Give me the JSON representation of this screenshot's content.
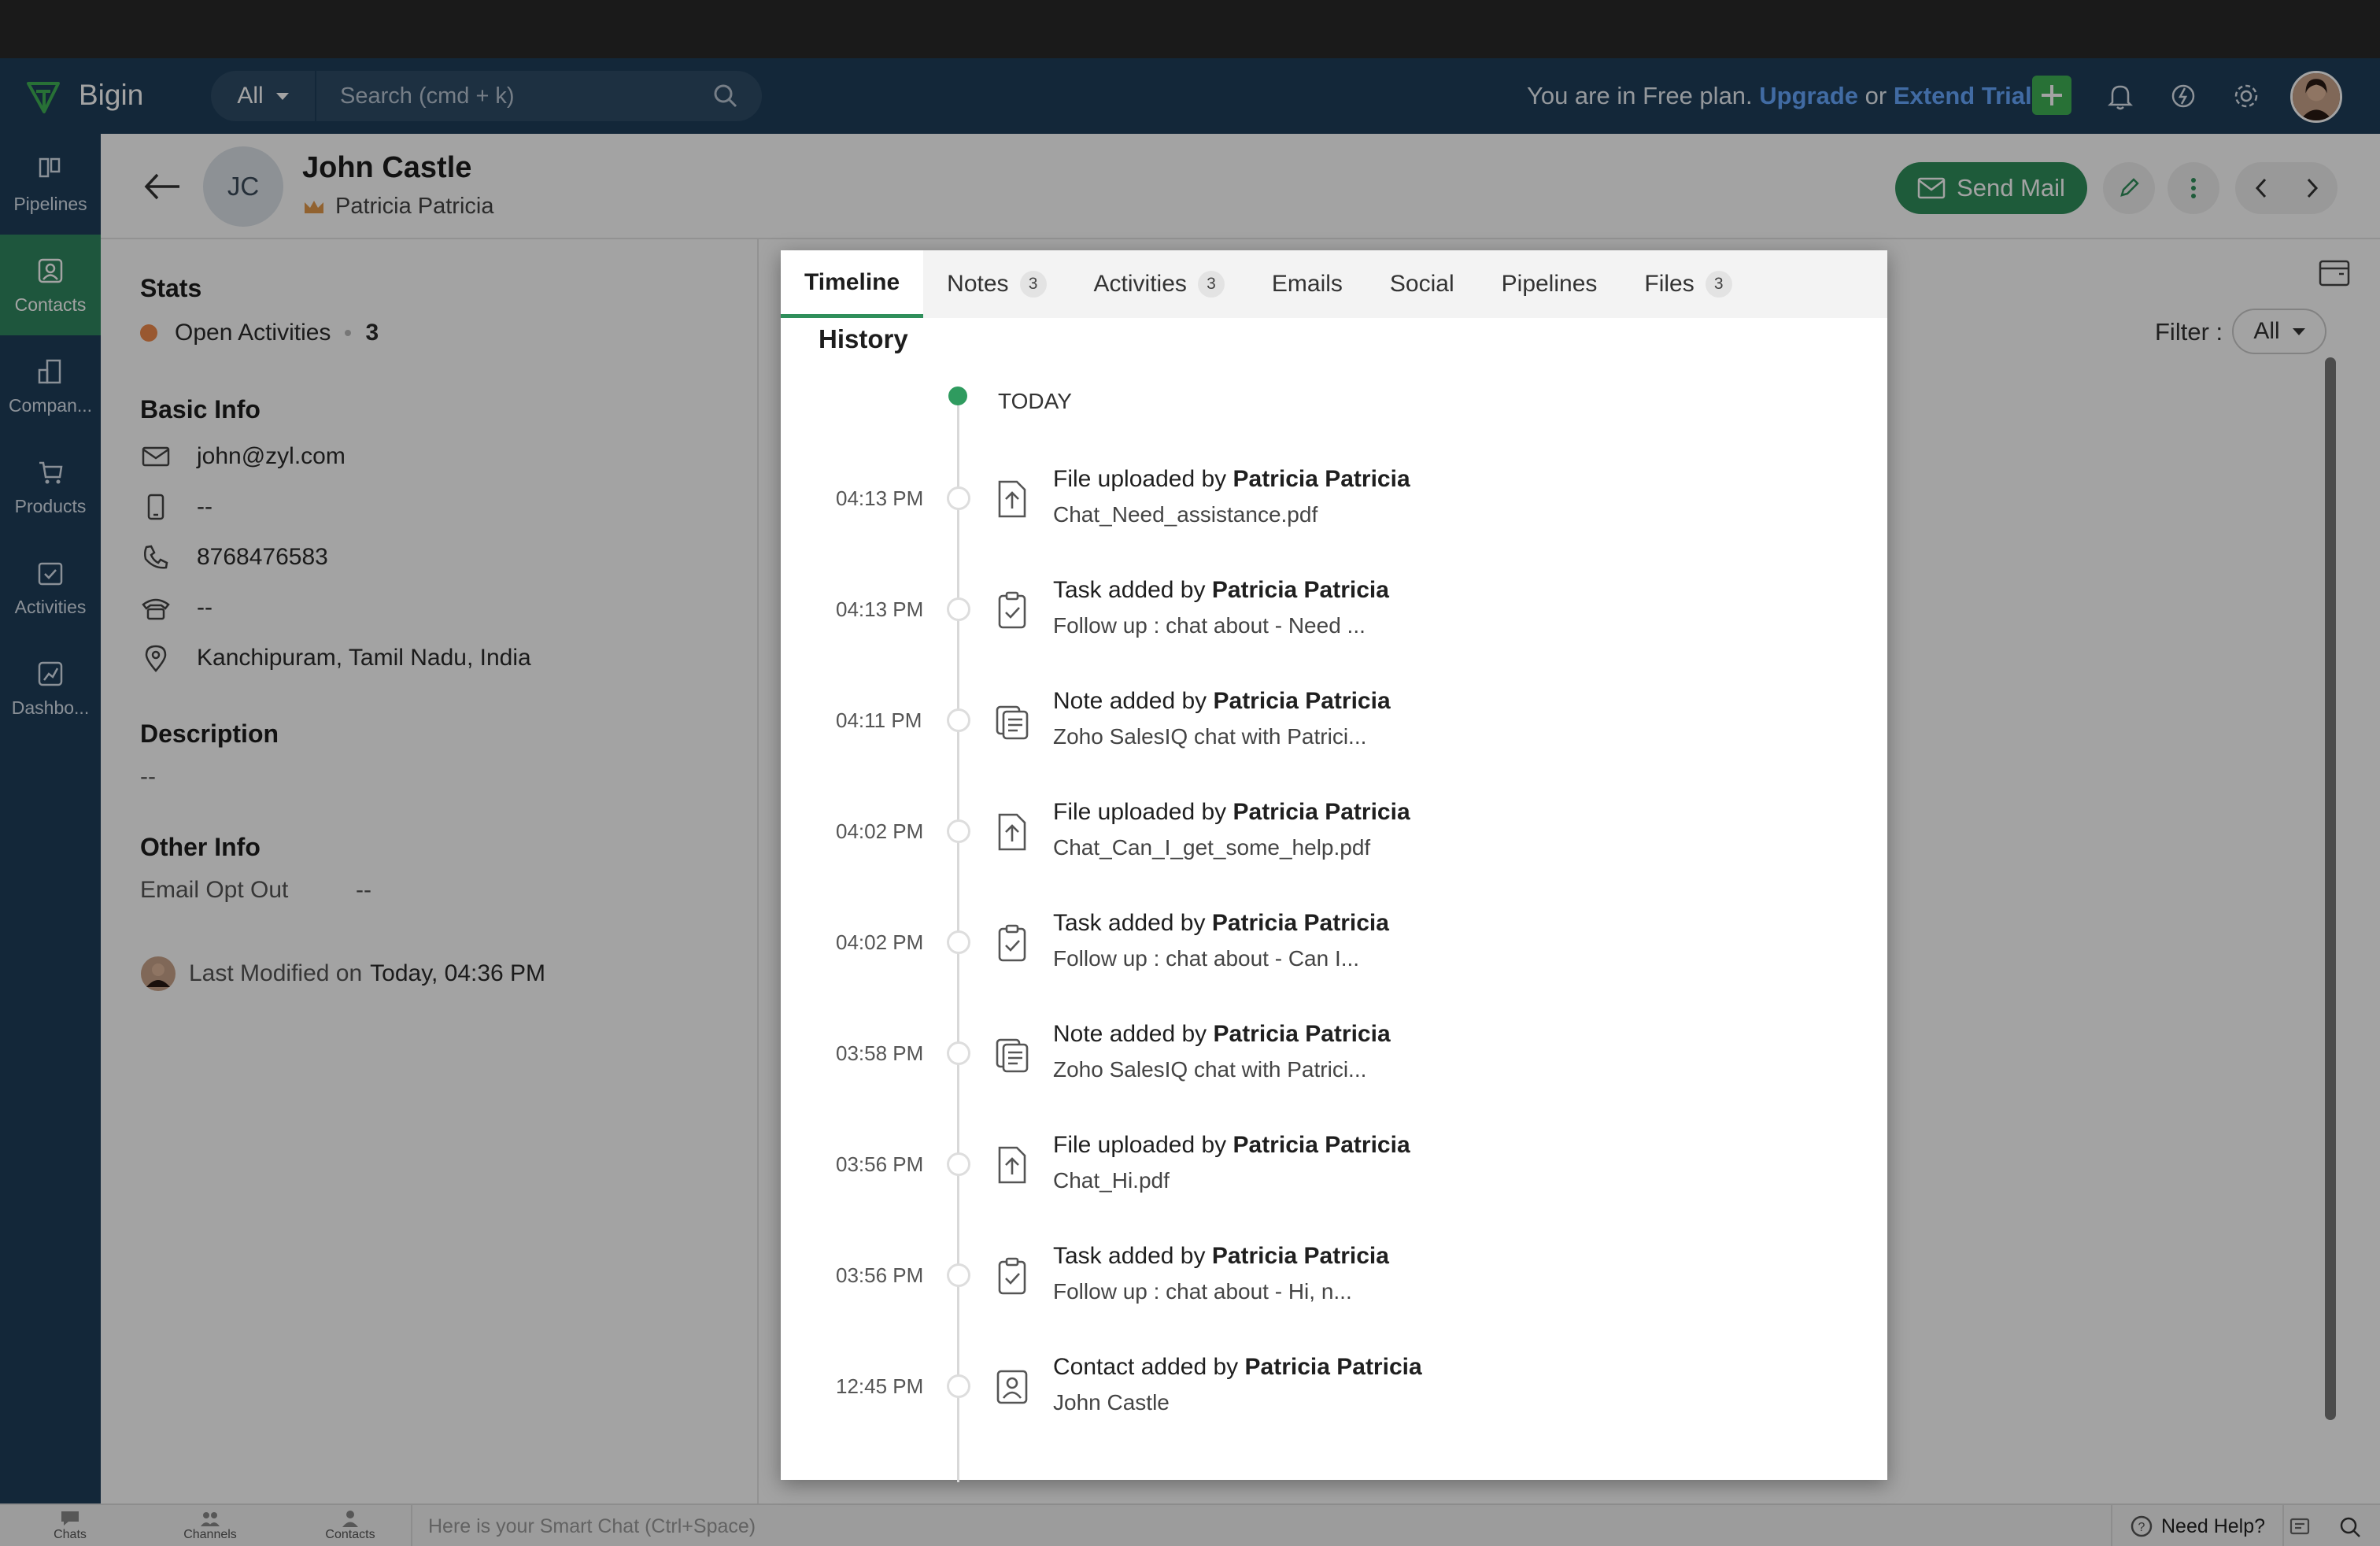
{
  "app": {
    "name": "Bigin"
  },
  "topbar": {
    "search_scope": "All",
    "search_placeholder": "Search (cmd + k)",
    "plan_text": "You are in Free plan.",
    "upgrade": "Upgrade",
    "or": "or",
    "extend_trial": "Extend Trial"
  },
  "sidebar": {
    "items": [
      {
        "label": "Pipelines",
        "icon": "pipelines-icon"
      },
      {
        "label": "Contacts",
        "icon": "contacts-icon",
        "active": true
      },
      {
        "label": "Compan...",
        "icon": "companies-icon"
      },
      {
        "label": "Products",
        "icon": "products-icon"
      },
      {
        "label": "Activities",
        "icon": "activities-icon"
      },
      {
        "label": "Dashbo...",
        "icon": "dashboards-icon"
      }
    ]
  },
  "contact": {
    "initials": "JC",
    "name": "John Castle",
    "owner": "Patricia Patricia",
    "send_mail": "Send Mail"
  },
  "details": {
    "stats_title": "Stats",
    "open_activities_label": "Open Activities",
    "open_activities_count": "3",
    "basic_info_title": "Basic Info",
    "email": "john@zyl.com",
    "mobile": "--",
    "phone": "8768476583",
    "other_phone": "--",
    "address": "Kanchipuram, Tamil Nadu, India",
    "description_title": "Description",
    "description": "--",
    "other_info_title": "Other Info",
    "email_opt_out_label": "Email Opt Out",
    "email_opt_out_value": "--",
    "last_modified_label": "Last Modified on",
    "last_modified_value": "Today, 04:36 PM"
  },
  "filter": {
    "label": "Filter :",
    "value": "All"
  },
  "tabs": [
    {
      "label": "Timeline",
      "count": ""
    },
    {
      "label": "Notes",
      "count": "3"
    },
    {
      "label": "Activities",
      "count": "3"
    },
    {
      "label": "Emails",
      "count": ""
    },
    {
      "label": "Social",
      "count": ""
    },
    {
      "label": "Pipelines",
      "count": ""
    },
    {
      "label": "Files",
      "count": "3"
    }
  ],
  "timeline": {
    "history_title": "History",
    "today_label": "TODAY",
    "events": [
      {
        "time": "04:13 PM",
        "type": "file",
        "action": "File uploaded by",
        "user": "Patricia Patricia",
        "detail": "Chat_Need_assistance.pdf"
      },
      {
        "time": "04:13 PM",
        "type": "task",
        "action": "Task added by",
        "user": "Patricia Patricia",
        "detail": "Follow up : chat about - Need ..."
      },
      {
        "time": "04:11 PM",
        "type": "note",
        "action": "Note added by",
        "user": "Patricia Patricia",
        "detail": "Zoho SalesIQ chat with Patrici..."
      },
      {
        "time": "04:02 PM",
        "type": "file",
        "action": "File uploaded by",
        "user": "Patricia Patricia",
        "detail": "Chat_Can_I_get_some_help.pdf"
      },
      {
        "time": "04:02 PM",
        "type": "task",
        "action": "Task added by",
        "user": "Patricia Patricia",
        "detail": "Follow up : chat about - Can I..."
      },
      {
        "time": "03:58 PM",
        "type": "note",
        "action": "Note added by",
        "user": "Patricia Patricia",
        "detail": "Zoho SalesIQ chat with Patrici..."
      },
      {
        "time": "03:56 PM",
        "type": "file",
        "action": "File uploaded by",
        "user": "Patricia Patricia",
        "detail": "Chat_Hi.pdf"
      },
      {
        "time": "03:56 PM",
        "type": "task",
        "action": "Task added by",
        "user": "Patricia Patricia",
        "detail": "Follow up : chat about - Hi, n..."
      },
      {
        "time": "12:45 PM",
        "type": "contact",
        "action": "Contact added by",
        "user": "Patricia Patricia",
        "detail": "John Castle"
      }
    ]
  },
  "bottombar": {
    "chats": "Chats",
    "channels": "Channels",
    "contacts": "Contacts",
    "smart_chat_placeholder": "Here is your Smart Chat (Ctrl+Space)",
    "need_help": "Need Help?"
  },
  "colors": {
    "topbar": "#1e3d59",
    "active_nav": "#2f8760",
    "send_mail": "#2f8f5b",
    "link": "#66a8ff",
    "today_dot": "#2f9b5f"
  }
}
